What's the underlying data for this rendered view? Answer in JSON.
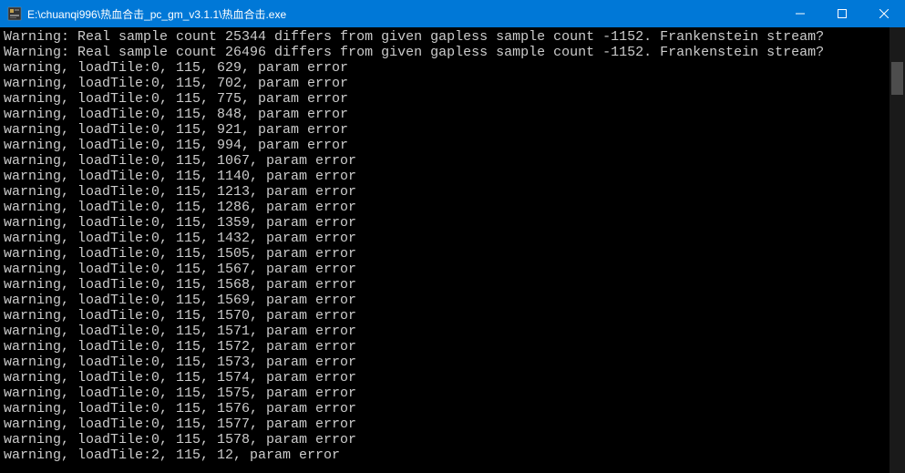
{
  "window": {
    "title": "E:\\chuanqi996\\热血合击_pc_gm_v3.1.1\\热血合击.exe"
  },
  "console": {
    "lines": [
      "Warning: Real sample count 25344 differs from given gapless sample count -1152. Frankenstein stream?",
      "",
      "Warning: Real sample count 26496 differs from given gapless sample count -1152. Frankenstein stream?",
      "warning, loadTile:0, 115, 629, param error",
      "warning, loadTile:0, 115, 702, param error",
      "warning, loadTile:0, 115, 775, param error",
      "warning, loadTile:0, 115, 848, param error",
      "warning, loadTile:0, 115, 921, param error",
      "warning, loadTile:0, 115, 994, param error",
      "warning, loadTile:0, 115, 1067, param error",
      "warning, loadTile:0, 115, 1140, param error",
      "warning, loadTile:0, 115, 1213, param error",
      "warning, loadTile:0, 115, 1286, param error",
      "warning, loadTile:0, 115, 1359, param error",
      "warning, loadTile:0, 115, 1432, param error",
      "warning, loadTile:0, 115, 1505, param error",
      "warning, loadTile:0, 115, 1567, param error",
      "warning, loadTile:0, 115, 1568, param error",
      "warning, loadTile:0, 115, 1569, param error",
      "warning, loadTile:0, 115, 1570, param error",
      "warning, loadTile:0, 115, 1571, param error",
      "warning, loadTile:0, 115, 1572, param error",
      "warning, loadTile:0, 115, 1573, param error",
      "warning, loadTile:0, 115, 1574, param error",
      "warning, loadTile:0, 115, 1575, param error",
      "warning, loadTile:0, 115, 1576, param error",
      "warning, loadTile:0, 115, 1577, param error",
      "warning, loadTile:0, 115, 1578, param error",
      "warning, loadTile:2, 115, 12, param error"
    ]
  }
}
